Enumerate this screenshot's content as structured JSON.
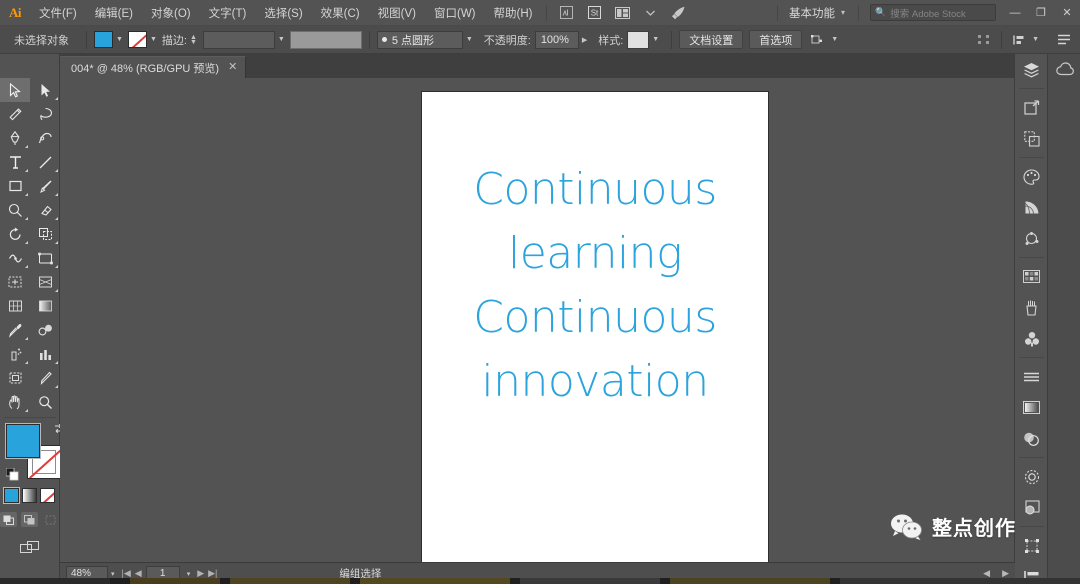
{
  "app": {
    "name": "Adobe Illustrator",
    "logo_text": "Ai"
  },
  "menubar": {
    "items": [
      {
        "label": "文件(F)"
      },
      {
        "label": "编辑(E)"
      },
      {
        "label": "对象(O)"
      },
      {
        "label": "文字(T)"
      },
      {
        "label": "选择(S)"
      },
      {
        "label": "效果(C)"
      },
      {
        "label": "视图(V)"
      },
      {
        "label": "窗口(W)"
      },
      {
        "label": "帮助(H)"
      }
    ],
    "icons": [
      {
        "name": "bridge-icon"
      },
      {
        "name": "stock-icon"
      },
      {
        "name": "arrange-documents-icon"
      },
      {
        "name": "arrange-caret-icon"
      },
      {
        "name": "rocket-icon"
      }
    ],
    "workspace": {
      "label": "基本功能",
      "caret": "▾"
    },
    "search": {
      "placeholder": "搜索 Adobe Stock",
      "value": "",
      "icon": "search-icon"
    },
    "window_controls": {
      "minimize": "—",
      "restore": "❐",
      "close": "✕"
    }
  },
  "controlbar": {
    "selection_label": "未选择对象",
    "fill": {
      "name": "fill-color",
      "color": "#29a3db"
    },
    "stroke": {
      "name": "stroke-color",
      "color": "none"
    },
    "stroke_weight_label": "描边:",
    "stroke_weight_value": "",
    "brush_value": "5 点圆形",
    "opacity_label": "不透明度:",
    "opacity_value": "100%",
    "style_label": "样式:",
    "doc_setup_button": "文档设置",
    "prefs_button": "首选项",
    "align_icon": "align-icon",
    "distribute_icon": "distribute-icon",
    "transform_icon": "transform-icon",
    "panel_menu_icon": "panel-menu-icon"
  },
  "tabbar": {
    "tabs": [
      {
        "label": "004* @ 48% (RGB/GPU 预览)",
        "close": "✕",
        "active": true
      }
    ]
  },
  "toolbar": {
    "tools": [
      {
        "name": "selection-tool",
        "glyph": "selection",
        "active": true
      },
      {
        "name": "direct-selection-tool",
        "glyph": "direct-selection",
        "active": false
      },
      {
        "name": "magic-wand-tool",
        "glyph": "magic-wand",
        "active": false
      },
      {
        "name": "lasso-tool",
        "glyph": "lasso",
        "active": false
      },
      {
        "name": "pen-tool",
        "glyph": "pen",
        "active": false
      },
      {
        "name": "curvature-tool",
        "glyph": "curvature",
        "active": false
      },
      {
        "name": "type-tool",
        "glyph": "type",
        "active": false
      },
      {
        "name": "line-segment-tool",
        "glyph": "line",
        "active": false
      },
      {
        "name": "rectangle-tool",
        "glyph": "rectangle",
        "active": false
      },
      {
        "name": "paintbrush-tool",
        "glyph": "paintbrush",
        "active": false
      },
      {
        "name": "shaper-tool",
        "glyph": "shaper",
        "active": false
      },
      {
        "name": "eraser-tool",
        "glyph": "eraser",
        "active": false
      },
      {
        "name": "rotate-tool",
        "glyph": "rotate",
        "active": false
      },
      {
        "name": "scale-tool",
        "glyph": "scale",
        "active": false
      },
      {
        "name": "width-tool",
        "glyph": "width",
        "active": false
      },
      {
        "name": "free-transform-tool",
        "glyph": "free-transform",
        "active": false
      },
      {
        "name": "shape-builder-tool",
        "glyph": "shape-builder",
        "active": false
      },
      {
        "name": "perspective-grid-tool",
        "glyph": "perspective",
        "active": false
      },
      {
        "name": "mesh-tool",
        "glyph": "mesh",
        "active": false
      },
      {
        "name": "gradient-tool",
        "glyph": "gradient",
        "active": false
      },
      {
        "name": "eyedropper-tool",
        "glyph": "eyedropper",
        "active": false
      },
      {
        "name": "blend-tool",
        "glyph": "blend",
        "active": false
      },
      {
        "name": "symbol-sprayer-tool",
        "glyph": "symbol-sprayer",
        "active": false
      },
      {
        "name": "column-graph-tool",
        "glyph": "graph",
        "active": false
      },
      {
        "name": "artboard-tool",
        "glyph": "artboard",
        "active": false
      },
      {
        "name": "slice-tool",
        "glyph": "slice",
        "active": false
      },
      {
        "name": "hand-tool",
        "glyph": "hand",
        "active": false
      },
      {
        "name": "zoom-tool",
        "glyph": "zoom",
        "active": false
      }
    ],
    "fill_stroke": {
      "fill_color": "#29a3db",
      "stroke_color": "none",
      "swap_icon": "swap-fill-stroke-icon",
      "default_icon": "default-fill-stroke-icon"
    },
    "color_modes": [
      {
        "name": "color-mode-color",
        "selected": true
      },
      {
        "name": "color-mode-gradient",
        "selected": false
      },
      {
        "name": "color-mode-none",
        "selected": false
      }
    ],
    "draw_modes": [
      {
        "name": "draw-normal-mode",
        "state": "on"
      },
      {
        "name": "draw-behind-mode",
        "state": "off"
      },
      {
        "name": "draw-inside-mode",
        "state": "disabled"
      }
    ],
    "screen_mode": {
      "name": "change-screen-mode-icon"
    }
  },
  "canvas": {
    "artboard": {
      "background": "#ffffff",
      "text_color": "#2ba3dc",
      "lines": [
        "Continuous",
        "learning",
        "Continuous",
        "innovation"
      ]
    },
    "vertical_scrollbar": {
      "name": "canvas-vertical-scrollbar"
    },
    "horizontal_scrollbar": {
      "name": "canvas-horizontal-scrollbar"
    }
  },
  "statusbar": {
    "zoom_value": "48%",
    "zoom_caret": "▾",
    "nav_first": "|◀",
    "nav_prev": "◀",
    "page_value": "1",
    "page_caret": "▾",
    "nav_next": "▶",
    "nav_last": "▶|",
    "status_text": "编组选择",
    "right_prev": "◀",
    "right_next": "▶"
  },
  "right_dock": {
    "column_a": [
      {
        "name": "layers-panel-icon",
        "group": 0
      },
      {
        "name": "artboards-panel-icon",
        "group": 1
      },
      {
        "name": "asset-export-panel-icon",
        "group": 1
      },
      {
        "name": "color-panel-icon",
        "group": 2
      },
      {
        "name": "color-guide-panel-icon",
        "group": 2
      },
      {
        "name": "recolor-artwork-panel-icon",
        "group": 2
      },
      {
        "name": "swatches-panel-icon",
        "group": 3
      },
      {
        "name": "brushes-panel-icon",
        "group": 3
      },
      {
        "name": "symbols-panel-icon",
        "group": 3
      },
      {
        "name": "stroke-panel-icon",
        "group": 4
      },
      {
        "name": "gradient-panel-icon",
        "group": 4
      },
      {
        "name": "transparency-panel-icon",
        "group": 4
      },
      {
        "name": "appearance-panel-icon",
        "group": 5
      },
      {
        "name": "graphic-styles-panel-icon",
        "group": 5
      },
      {
        "name": "transform-panel-icon",
        "group": 6
      },
      {
        "name": "align-panel-icon",
        "group": 6
      }
    ],
    "column_b": [
      {
        "name": "libraries-panel-icon"
      }
    ]
  },
  "watermark": {
    "text": "整点创作",
    "icon": "wechat-icon"
  }
}
